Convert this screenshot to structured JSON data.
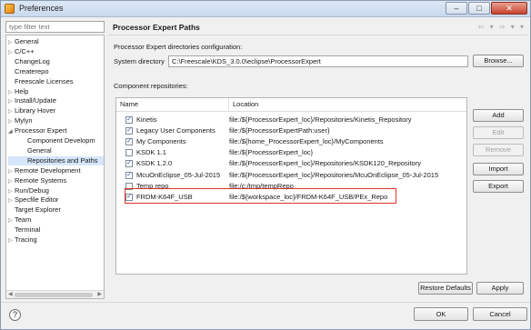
{
  "window": {
    "title": "Preferences",
    "buttons": {
      "minimize": "–",
      "maximize": "□",
      "close": "✕"
    }
  },
  "sidebar": {
    "filter_placeholder": "type filter text",
    "items": [
      {
        "label": "General",
        "expander": "▷"
      },
      {
        "label": "C/C++",
        "expander": "▷"
      },
      {
        "label": "ChangeLog",
        "expander": ""
      },
      {
        "label": "Createrepo",
        "expander": ""
      },
      {
        "label": "Freescale Licenses",
        "expander": ""
      },
      {
        "label": "Help",
        "expander": "▷"
      },
      {
        "label": "Install/Update",
        "expander": "▷"
      },
      {
        "label": "Library Hover",
        "expander": "▷"
      },
      {
        "label": "Mylyn",
        "expander": "▷"
      },
      {
        "label": "Processor Expert",
        "expander": "◢"
      },
      {
        "label": "Component Developm",
        "expander": ""
      },
      {
        "label": "General",
        "expander": ""
      },
      {
        "label": "Repositories and Paths",
        "expander": "",
        "selected": true
      },
      {
        "label": "Remote Development",
        "expander": "▷"
      },
      {
        "label": "Remote Systems",
        "expander": "▷"
      },
      {
        "label": "Run/Debug",
        "expander": "▷"
      },
      {
        "label": "Specfile Editor",
        "expander": "▷"
      },
      {
        "label": "Target Explorer",
        "expander": ""
      },
      {
        "label": "Team",
        "expander": "▷"
      },
      {
        "label": "Terminal",
        "expander": ""
      },
      {
        "label": "Tracing",
        "expander": "▷"
      }
    ]
  },
  "page": {
    "title": "Processor Expert Paths",
    "nav_arrows": "⇦ ▾ ⇨ ▾ ▾",
    "directories_label": "Processor Expert directories configuration:",
    "system_directory_label": "System directory",
    "system_directory_value": "C:\\Freescale\\KDS_3.0.0\\eclipse\\ProcessorExpert",
    "browse_label": "Browse...",
    "repositories_label": "Component repositories:",
    "columns": [
      "Name",
      "Location"
    ],
    "rows": [
      {
        "checked": true,
        "name": "Kinetis",
        "location": "file:/${ProcessorExpert_loc}/Repositories/Kinetis_Repository"
      },
      {
        "checked": true,
        "name": "Legacy User Components",
        "location": "file:/${ProcessorExpertPath:user}"
      },
      {
        "checked": true,
        "name": "My Components",
        "location": "file:/${home_ProcessorExpert_loc}/MyComponents"
      },
      {
        "checked": false,
        "name": "KSDK 1.1",
        "location": "file:/${ProcessorExpert_loc}"
      },
      {
        "checked": true,
        "name": "KSDK 1.2.0",
        "location": "file:/${ProcessorExpert_loc}/Repositories/KSDK120_Repository"
      },
      {
        "checked": true,
        "name": "McuOnEclipse_05-Jul-2015",
        "location": "file:/${ProcessorExpert_loc}/Repositories/McuOnEclipse_05-Jul-2015"
      },
      {
        "checked": false,
        "name": "Temp repo",
        "location": "file:/c:/tmp/tempRepo"
      },
      {
        "checked": true,
        "name": "FRDM-K64F_USB",
        "location": "file:/${workspace_loc}/FRDM-K64F_USB/PEx_Repo",
        "highlight": true
      }
    ],
    "side_buttons": {
      "add": "Add",
      "edit": "Edit",
      "remove": "Remove",
      "import": "Import",
      "export": "Export"
    },
    "restore_defaults": "Restore Defaults",
    "apply": "Apply"
  },
  "footer": {
    "help": "?",
    "ok": "OK",
    "cancel": "Cancel"
  },
  "colors": {
    "highlight_border": "#e0332b",
    "selection": "#d6e6fb"
  }
}
